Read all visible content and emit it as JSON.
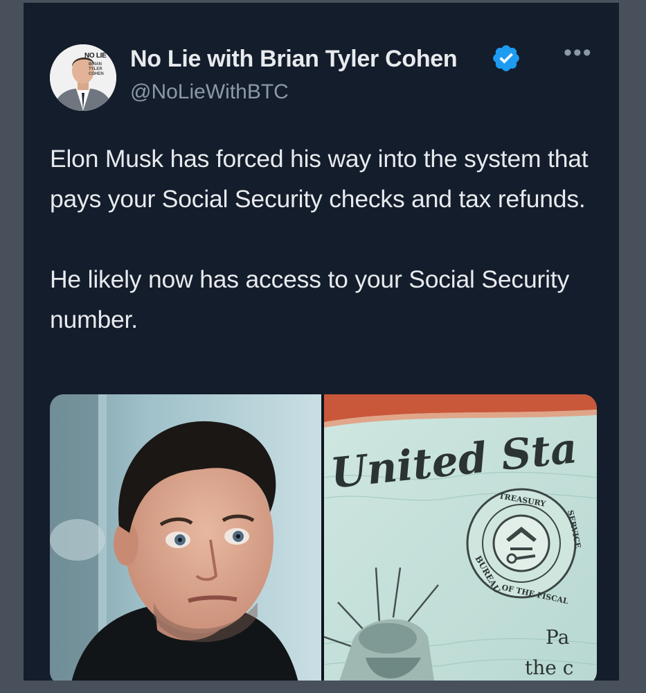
{
  "tweet": {
    "display_name": "No Lie with Brian Tyler Cohen",
    "handle": "@NoLieWithBTC",
    "verified_icon": "verified-badge-icon",
    "more_label": "•••",
    "avatar": {
      "logo_text": "NO LIE",
      "logo_sub": [
        "BRIAN",
        "TYLER",
        "COHEN"
      ]
    },
    "paragraphs": [
      "Elon Musk has forced his way into the system that pays your Social Security checks and tax refunds.",
      "He likely now has access to your Social Security number."
    ],
    "media": {
      "left_image": "photo-man-portrait",
      "right_image": "photo-treasury-check",
      "check_text": {
        "heading": "United Sta",
        "seal_top": "TREASURY",
        "seal_left": "BUREAU",
        "seal_bottom": "OF THE FISCAL",
        "seal_right": "SERVICE",
        "pay_text": "Pa",
        "the_text": "the c"
      }
    }
  },
  "colors": {
    "background": "#48505c",
    "card": "#141d2b",
    "text": "#e8ebee",
    "secondary_text": "#8d99a6",
    "verified": "#1d9bf0"
  }
}
